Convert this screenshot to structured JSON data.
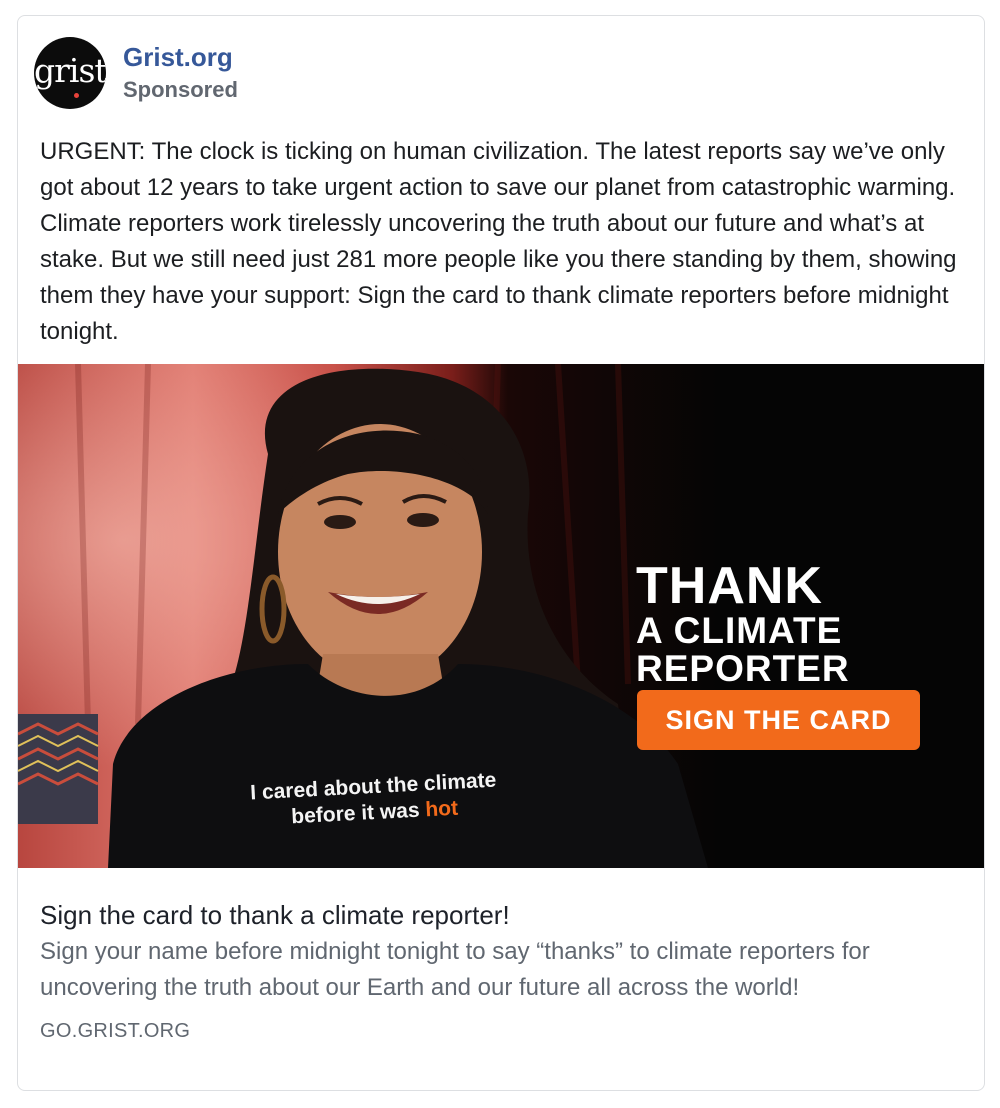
{
  "post": {
    "page_name": "Grist.org",
    "sponsored_label": "Sponsored",
    "avatar_logo_text": "grist",
    "body_text": "URGENT: The clock is ticking on human civilization. The latest reports say we’ve only got about 12 years to take urgent action to save our planet from catastrophic warming. Climate reporters work tirelessly uncovering the truth about our future and what’s at stake. But we still need just 281 more people like you there standing by them, showing them they have your support: Sign the card to thank climate reporters before midnight tonight."
  },
  "creative": {
    "headline_line1": "THANK",
    "headline_line2": "A CLIMATE",
    "headline_line3": "REPORTER",
    "cta_label": "SIGN THE CARD",
    "shirt_line1": "I cared about the climate",
    "shirt_line2_prefix": "before it was",
    "shirt_line2_highlight": "hot"
  },
  "link": {
    "title": "Sign the card to thank a climate reporter!",
    "description": "Sign your name before midnight tonight to say “thanks” to climate reporters for uncovering the truth about our Earth and our future all across the world!",
    "domain": "GO.GRIST.ORG"
  },
  "colors": {
    "page_name": "#365899",
    "cta_button": "#f26a1b",
    "secondary_text": "#606770"
  }
}
